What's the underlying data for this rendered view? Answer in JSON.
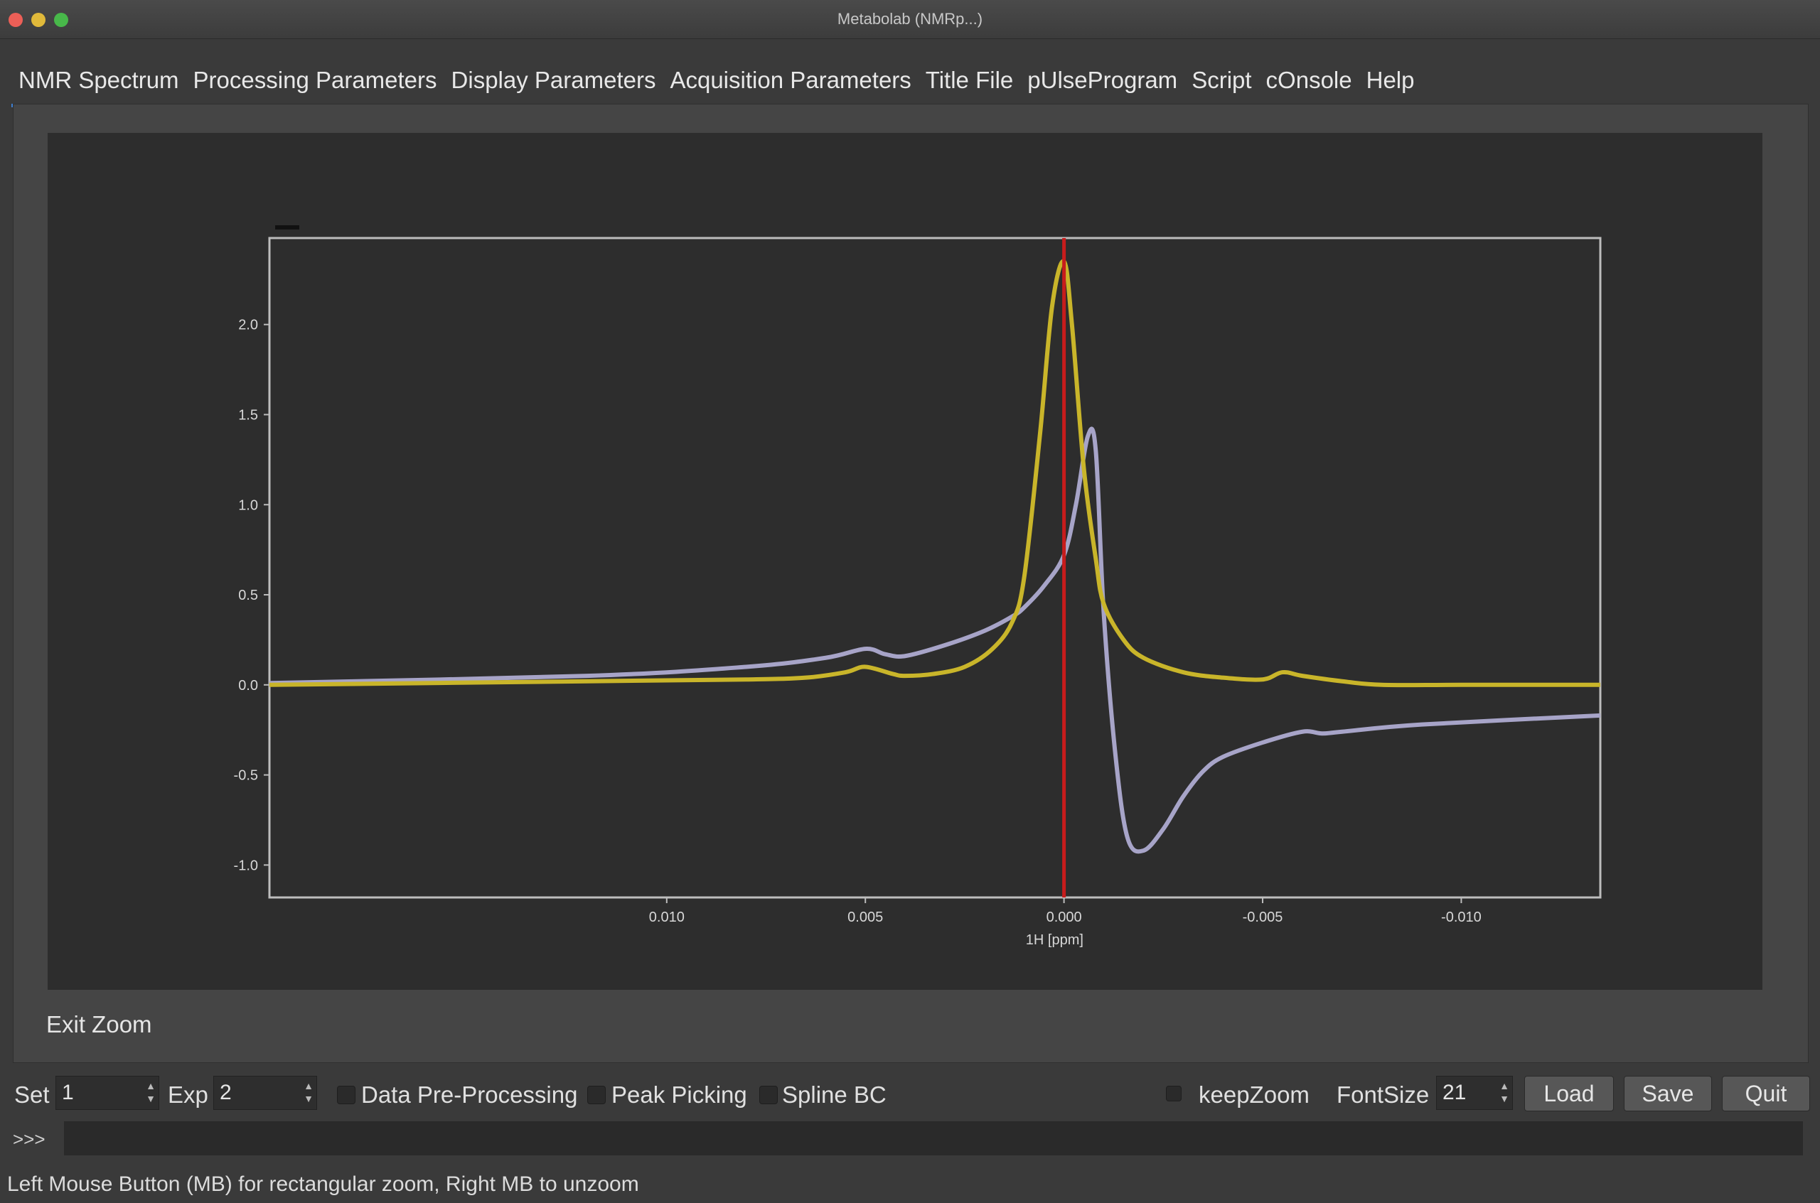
{
  "window": {
    "title": "Metabolab (NMRp...)"
  },
  "tabs": [
    {
      "label": "NMR Spectrum"
    },
    {
      "label": "Processing Parameters"
    },
    {
      "label": "Display Parameters"
    },
    {
      "label": "Acquisition Parameters"
    },
    {
      "label": "Title File"
    },
    {
      "label": "pUlseProgram"
    },
    {
      "label": "Script"
    },
    {
      "label": "cOnsole"
    },
    {
      "label": "Help"
    }
  ],
  "exit_zoom_label": "Exit Zoom",
  "controls": {
    "set_label": "Set",
    "set_value": "1",
    "exp_label": "Exp",
    "exp_value": "2",
    "pre_processing_label": "Data Pre-Processing",
    "peak_picking_label": "Peak Picking",
    "spline_bc_label": "Spline BC",
    "keep_zoom_label": "keepZoom",
    "font_size_label": "FontSize",
    "font_size_value": "21",
    "load_label": "Load",
    "save_label": "Save",
    "quit_label": "Quit"
  },
  "console": {
    "prompt": ">>>",
    "value": ""
  },
  "status": {
    "text": "Left Mouse Button (MB) for rectangular zoom, Right MB to unzoom"
  },
  "colors": {
    "real": "#c9b52a",
    "imag": "#a7a4c8",
    "cursor": "#c81c1c",
    "accent": "#3f7fd1"
  },
  "chart_data": {
    "type": "line",
    "title": "",
    "xlabel": "1H [ppm]",
    "ylabel": "",
    "xlim": [
      0.02,
      -0.0135
    ],
    "ylim": [
      -1.18,
      2.48
    ],
    "x_ticks": [
      0.01,
      0.005,
      0.0,
      -0.005,
      -0.01
    ],
    "x_tick_labels": [
      "0.010",
      "0.005",
      "0.000",
      "-0.005",
      "-0.010"
    ],
    "y_ticks": [
      2.0,
      1.5,
      1.0,
      0.5,
      0.0,
      -0.5,
      -1.0
    ],
    "y_tick_labels": [
      "2.0",
      "1.5",
      "1.0",
      "0.5",
      "0.0",
      "-0.5",
      "-1.0"
    ],
    "cursor_x": 0.0,
    "series": [
      {
        "color": "#c9b52a",
        "x": [
          0.02,
          0.012,
          0.008,
          0.0065,
          0.0055,
          0.005,
          0.0043,
          0.004,
          0.0033,
          0.0025,
          0.0018,
          0.0013,
          0.001,
          0.0006,
          0.0003,
          0.0,
          -0.0002,
          -0.0005,
          -0.0008,
          -0.001,
          -0.0015,
          -0.002,
          -0.003,
          -0.004,
          -0.005,
          -0.0055,
          -0.006,
          -0.007,
          -0.008,
          -0.01,
          -0.0135
        ],
        "y": [
          0.0,
          0.02,
          0.03,
          0.04,
          0.07,
          0.1,
          0.06,
          0.05,
          0.06,
          0.1,
          0.2,
          0.35,
          0.6,
          1.4,
          2.1,
          2.35,
          2.0,
          1.2,
          0.7,
          0.45,
          0.25,
          0.15,
          0.07,
          0.04,
          0.03,
          0.07,
          0.05,
          0.02,
          0.0,
          0.0,
          0.0
        ]
      },
      {
        "color": "#a7a4c8",
        "x": [
          0.02,
          0.012,
          0.008,
          0.006,
          0.005,
          0.0045,
          0.004,
          0.003,
          0.002,
          0.0013,
          0.001,
          0.0005,
          0.0,
          -0.0003,
          -0.0006,
          -0.0008,
          -0.001,
          -0.0013,
          -0.0016,
          -0.002,
          -0.0025,
          -0.003,
          -0.0035,
          -0.004,
          -0.005,
          -0.006,
          -0.0065,
          -0.007,
          -0.009,
          -0.0135
        ],
        "y": [
          0.01,
          0.05,
          0.1,
          0.15,
          0.2,
          0.17,
          0.16,
          0.22,
          0.3,
          0.38,
          0.43,
          0.55,
          0.72,
          1.0,
          1.38,
          1.3,
          0.4,
          -0.4,
          -0.85,
          -0.92,
          -0.8,
          -0.62,
          -0.48,
          -0.4,
          -0.32,
          -0.26,
          -0.27,
          -0.26,
          -0.22,
          -0.17
        ]
      }
    ]
  }
}
